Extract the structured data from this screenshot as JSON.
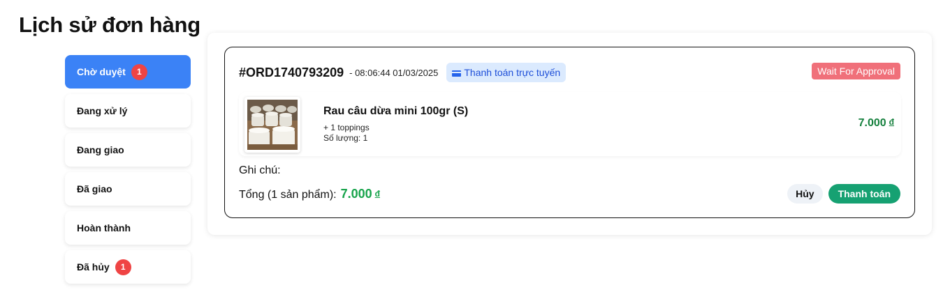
{
  "page": {
    "title": "Lịch sử đơn hàng"
  },
  "sidebar": {
    "items": [
      {
        "label": "Chờ duyệt",
        "badge": "1",
        "active": true
      },
      {
        "label": "Đang xử lý"
      },
      {
        "label": "Đang giao"
      },
      {
        "label": "Đã giao"
      },
      {
        "label": "Hoàn thành"
      },
      {
        "label": "Đã hủy",
        "badge": "1"
      }
    ]
  },
  "order": {
    "id": "#ORD1740793209",
    "time": "- 08:06:44 01/03/2025",
    "payment_method": "Thanh toán trực tuyến",
    "payment_icon": "credit-card-icon",
    "status": "Wait For Approval",
    "items": [
      {
        "name": "Rau câu dừa mini 100gr (S)",
        "toppings": "+ 1 toppings",
        "quantity": "Số lượng: 1",
        "price": "7.000",
        "currency": "đ"
      }
    ],
    "note_label": "Ghi chú:",
    "total_label": "Tổng (1 sản phẩm):",
    "total_amount": "7.000",
    "total_currency": "đ",
    "actions": {
      "cancel": "Hủy",
      "pay": "Thanh toán"
    }
  },
  "colors": {
    "active_tab": "#3b82f6",
    "badge": "#ef4444",
    "status_badge": "#f0707a",
    "pay_button": "#16a172",
    "price": "#15803d"
  }
}
